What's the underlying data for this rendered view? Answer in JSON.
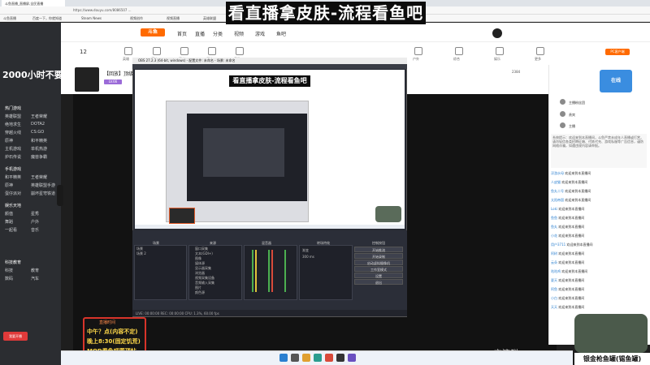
{
  "browser": {
    "tab_title": "斗鱼直播_直播屏,全民直播",
    "url": "https://www.douyu.com/8086507 ...",
    "bookmarks": [
      "斗鱼直播",
      "百度一下，你就知道",
      "Steam News",
      "视频创作",
      "视频直播",
      "英雄联盟"
    ]
  },
  "overlay_title": "看直播拿皮肤-流程看鱼吧",
  "site": {
    "logo": "斗鱼",
    "nav": [
      "首页",
      "直播",
      "分类",
      "视频",
      "游戏",
      "鱼吧"
    ],
    "categories": [
      "12",
      "英雄",
      "魔法",
      "王者",
      "原神",
      "手游",
      "主机",
      "单机",
      "音乐",
      "舞蹈",
      "户外",
      "综合",
      "娱乐",
      "更多"
    ],
    "pc_button": "PC客户端"
  },
  "sidebar": {
    "banner": "2000小时不要忘",
    "sections": [
      {
        "title": "热门游戏",
        "items": [
          "英雄联盟",
          "王者荣耀",
          "绝地求生",
          "DOTA2",
          "穿越火线",
          "CS:GO",
          "原神",
          "和平精英",
          "主机游戏",
          "单机热游",
          "炉石传说",
          "魔兽争霸",
          "暴雪游戏",
          "DNF",
          "守望先锋",
          "永劫无间"
        ]
      },
      {
        "title": "手机游戏",
        "items": [
          "和平精英",
          "王者荣耀",
          "原神",
          "英雄联盟手游",
          "蛋仔派对",
          "崩坏星穹铁道"
        ]
      },
      {
        "title": "娱乐天地",
        "items": [
          "颜值",
          "星秀",
          "舞蹈",
          "户外",
          "一起看",
          "音乐"
        ]
      },
      {
        "title": "科技教育",
        "items": [
          "科技",
          "教育",
          "数码",
          "汽车"
        ]
      }
    ],
    "live_button": "我要开播"
  },
  "room": {
    "title": "【回放】顶级直播间",
    "tag": "LV.66",
    "fans": "2384"
  },
  "obs": {
    "title": "OBS 27.2.3 (64-bit, windows) - 配置文件: 未命名 - 场景: 未命名",
    "inner_title": "看直播拿皮肤-流程看鱼吧",
    "docks": [
      "场景",
      "来源",
      "混音器",
      "转场特效",
      "控制按钮"
    ],
    "scenes": [
      "场景",
      "场景 2"
    ],
    "sources": [
      "窗口采集",
      "文本(GDI+)",
      "图像",
      "媒体源",
      "显示器采集",
      "浏览器",
      "视频采集设备",
      "音频输入采集",
      "图片",
      "颜色源"
    ],
    "controls": [
      "开始推流",
      "开始录制",
      "启动虚拟摄像机",
      "工作室模式",
      "设置",
      "退出"
    ],
    "status": "LIVE: 00:00:00  REC: 00:00:00  CPU: 1.3%, 60.00 fps",
    "fade_label": "渐变",
    "duration": "300 ms"
  },
  "schedule_card": {
    "header": "直播时间",
    "lines": [
      "中午？点(内容不定)",
      "晚上8:30(固定饥荒)",
      "MOD看鱼吧置顶帖"
    ]
  },
  "fish_label": "银金枪鱼罐(锡鱼罐)",
  "bottom_overlay": "Q交流群:75",
  "chat": {
    "hero": "在线",
    "ranks": [
      {
        "name": "主播粉丝团",
        "score": "1"
      },
      {
        "name": "贵宾",
        "score": "2"
      },
      {
        "name": "主播",
        "score": "3"
      }
    ],
    "notice": "系统提示：欢迎来到本直播间，斗鱼严禁未成年人直播或打赏，请勿轻信各类招聘征婚、代练代充、游戏私服等广告信息，谨防网络诈骗，如遇违规内容请举报。",
    "messages": [
      {
        "user": "浮游水母",
        "msg": "欢迎来到本直播间"
      },
      {
        "user": "人皮猫",
        "msg": "欢迎来到本直播间"
      },
      {
        "user": "鱼丸二号",
        "msg": "欢迎来到本直播间"
      },
      {
        "user": "太阳帝国",
        "msg": "欢迎来到本直播间"
      },
      {
        "user": "Loki",
        "msg": "欢迎来到本直播间"
      },
      {
        "user": "鱼鱼",
        "msg": "欢迎来到本直播间"
      },
      {
        "user": "鱼丸",
        "msg": "欢迎来到本直播间"
      },
      {
        "user": "小花",
        "msg": "欢迎来到本直播间"
      },
      {
        "user": "用户3711",
        "msg": "欢迎来到本直播间"
      },
      {
        "user": "阿树",
        "msg": "欢迎来到本直播间"
      },
      {
        "user": "云朵",
        "msg": "欢迎来到本直播间"
      },
      {
        "user": "咕咕鸡",
        "msg": "欢迎来到本直播间"
      },
      {
        "user": "夏天",
        "msg": "欢迎来到本直播间"
      },
      {
        "user": "阿鱼",
        "msg": "欢迎来到本直播间"
      },
      {
        "user": "小白",
        "msg": "欢迎来到本直播间"
      },
      {
        "user": "天天",
        "msg": "欢迎来到本直播间"
      },
      {
        "user": "大熊",
        "msg": "欢迎来到本直播间"
      },
      {
        "user": "Angel",
        "msg": "欢迎来到本直播间"
      }
    ]
  },
  "colors": {
    "accent": "#ff6a00",
    "schedule_border": "#d8342a",
    "schedule_text": "#ffd94a",
    "link": "#2a7fd0"
  }
}
